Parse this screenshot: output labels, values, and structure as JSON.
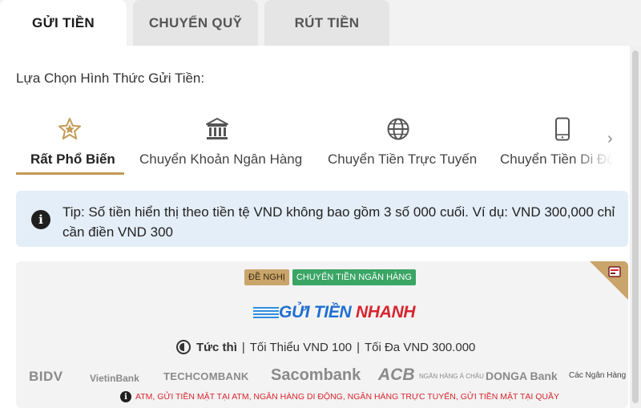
{
  "tabs": [
    {
      "label": "GỬI TIỀN",
      "active": true
    },
    {
      "label": "CHUYỂN QUỸ",
      "active": false
    },
    {
      "label": "RÚT TIỀN",
      "active": false
    }
  ],
  "prompt": "Lựa Chọn Hình Thức Gửi Tiền:",
  "methods": [
    {
      "label": "Rất Phổ Biến",
      "icon": "star-icon",
      "active": true
    },
    {
      "label": "Chuyển Khoản Ngân Hàng",
      "icon": "bank-icon",
      "active": false
    },
    {
      "label": "Chuyển Tiền Trực Tuyến",
      "icon": "globe-icon",
      "active": false
    },
    {
      "label": "Chuyển Tiền Di Động",
      "icon": "phone-icon",
      "active": false
    }
  ],
  "tip": {
    "icon": "info-icon",
    "text": "Tip: Số tiền hiển thị theo tiền tệ VND không bao gồm 3 số 000 cuối. Ví dụ: VND 300,000 chỉ cần điền VND 300"
  },
  "card": {
    "badges": [
      "ĐỀ NGHỊ",
      "CHUYỂN TIỀN NGÂN HÀNG"
    ],
    "logo_part1": "GỬI TIỀN",
    "logo_part2": "NHANH",
    "speed": "Tức thì",
    "separator": "|",
    "min": "Tối Thiểu VND 100",
    "max": "Tối Đa VND 300.000",
    "banks": [
      "BIDV",
      "VietinBank",
      "TECHCOMBANK",
      "Sacombank",
      "ACB",
      "NGÂN HÀNG Á CHÂU",
      "DONGA Bank",
      "Các Ngân Hàng"
    ],
    "note": "ATM, GỬI TIỀN MẶT TẠI ATM, NGÂN HÀNG DI ĐỘNG, NGÂN HÀNG TRỰC TUYẾN, GỬI TIỀN MẶT TẠI QUẦY"
  },
  "colors": {
    "accent_gold": "#c49a55",
    "tip_bg": "#e4eef8",
    "badge_green": "#3aa564",
    "logo_blue": "#1f6fd1",
    "logo_red": "#d8252d"
  }
}
